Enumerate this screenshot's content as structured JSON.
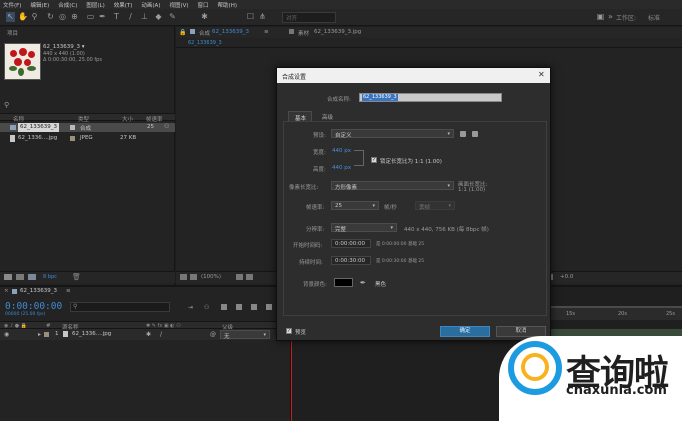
{
  "menubar": [
    "文件(F)",
    "编辑(E)",
    "合成(C)",
    "图层(L)",
    "效果(T)",
    "动画(A)",
    "视图(V)",
    "窗口",
    "帮助(H)"
  ],
  "toolbar": {
    "icons": [
      "selection-tool-icon",
      "hand-tool-icon",
      "zoom-tool-icon",
      "rotate-tool-icon",
      "camera-tool-icon",
      "pan-behind-icon",
      "rectangle-tool-icon",
      "pen-tool-icon",
      "text-tool-icon",
      "brush-tool-icon",
      "clone-stamp-icon",
      "eraser-icon",
      "roto-brush-icon",
      "puppet-pin-icon"
    ],
    "snap_label": "对齐",
    "workspace_label": "工作区:",
    "workspace_value": "标准"
  },
  "project": {
    "tab": "项目",
    "selected_name": "62_133639_3 ▾",
    "info_size": "440 x 440 (1.00)",
    "info_duration": "Δ 0:00:30:00, 25.00 fps",
    "columns": [
      "名称",
      "类型",
      "大小",
      "帧速率"
    ],
    "items": [
      {
        "name": "62_133639_3",
        "type": "合成",
        "size": "",
        "fps": "25",
        "selected": true
      },
      {
        "name": "62_1336....jpg",
        "type": "JPEG",
        "size": "27 KB",
        "fps": "",
        "selected": false
      }
    ],
    "bpc": "8 bpc"
  },
  "viewer": {
    "tab_comp": "合成",
    "tab_comp_name": "62_133639_3",
    "tab_footage": "素材",
    "tab_footage_name": "62_133639_3.jpg",
    "sub_tab": "62_133639_3",
    "zoom": "(100%)",
    "offset": "+0.0"
  },
  "timeline": {
    "comp_tab": "62_133639_3",
    "timecode": "0:00:00:00",
    "frames": "00000 (25.00 fps)",
    "columns": [
      "#",
      "源名称",
      "父级"
    ],
    "layer": {
      "index": "1",
      "name": "62_1336....jpg",
      "parent": "无"
    },
    "ruler_marks": [
      "15s",
      "20s",
      "25s"
    ]
  },
  "dialog": {
    "title": "合成设置",
    "name_label": "合成名称:",
    "name_value": "62_133639_3",
    "tabs": [
      "基本",
      "高级"
    ],
    "preset_label": "预设:",
    "preset_value": "自定义",
    "width_label": "宽度:",
    "width_value": "440 px",
    "height_label": "高度:",
    "height_value": "440 px",
    "lock_label": "锁定长宽比为 1:1 (1.00)",
    "pixel_aspect_label": "像素长宽比:",
    "pixel_aspect_value": "方形像素",
    "frame_aspect_label": "画面长宽比:",
    "frame_aspect_value": "1:1 (1.00)",
    "fps_label": "帧速率:",
    "fps_value": "25",
    "fps_unit": "帧/秒",
    "drop_frame": "丢帧",
    "resolution_label": "分辨率:",
    "resolution_value": "完整",
    "resolution_info": "440 x 440, 756 KB (每 8bpc 帧)",
    "start_label": "开始时间码:",
    "start_value": "0:00:00:00",
    "start_info": "是 0:00:00:00 基础 25",
    "duration_label": "持续时间:",
    "duration_value": "0:00:30:00",
    "duration_info": "是 0:00:30:00 基础 25",
    "bg_label": "背景颜色:",
    "bg_color": "#000000",
    "bg_name": "黑色",
    "preview_label": "预览",
    "ok_label": "确定",
    "cancel_label": "取消"
  },
  "watermark": {
    "cn": "查询啦",
    "url": "chaxunla.com",
    "brand_blue": "#1c9be0",
    "brand_yellow": "#f7b21d"
  }
}
